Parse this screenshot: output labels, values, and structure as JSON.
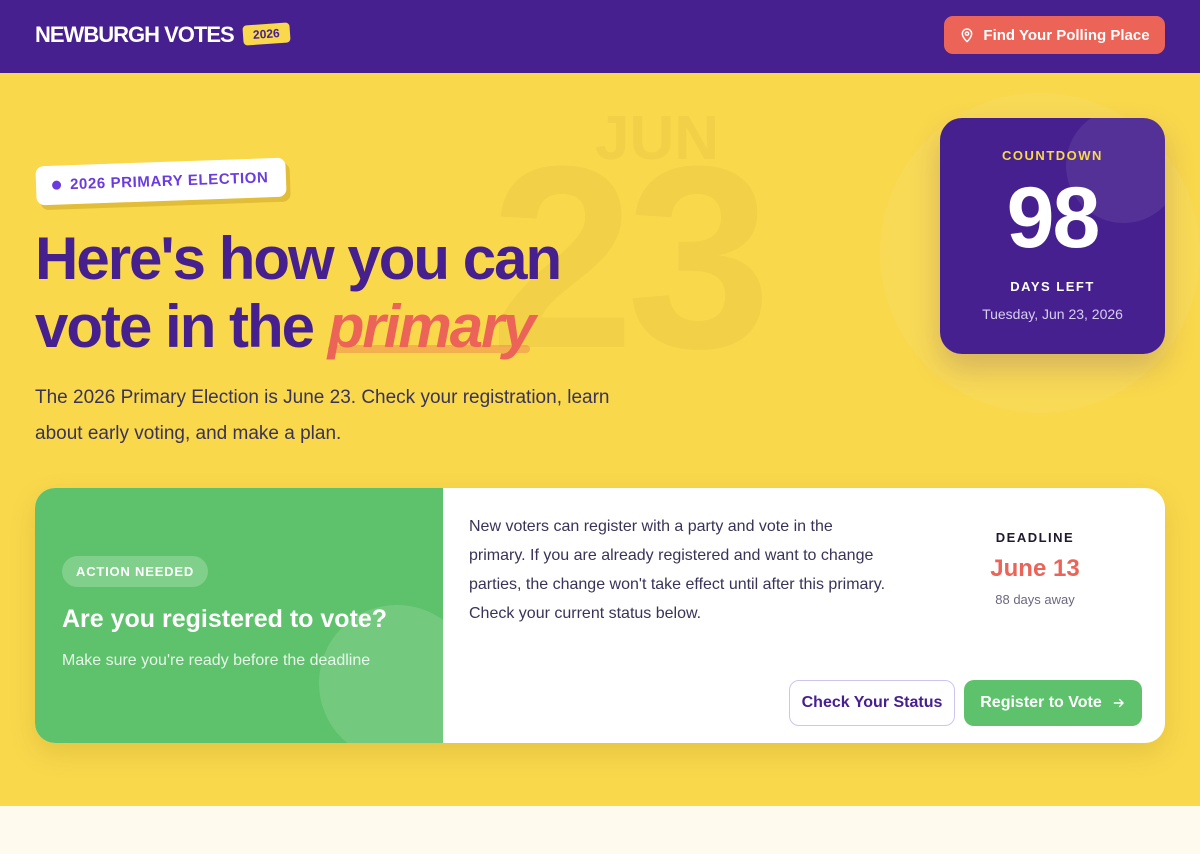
{
  "header": {
    "brand": "NEWBURGH VOTES",
    "year_badge": "2026",
    "polling_button": "Find Your Polling Place"
  },
  "hero": {
    "watermark_month": "JUN",
    "watermark_day": "23",
    "tag": "2026 PRIMARY ELECTION",
    "headline_line1": "Here's how you can",
    "headline_line2_prefix": "vote in the ",
    "headline_emphasis": "primary",
    "intro": "The 2026 Primary Election is June 23. Check your registration, learn about early voting, and make a plan."
  },
  "countdown": {
    "label": "COUNTDOWN",
    "value": "98",
    "sublabel": "DAYS LEFT",
    "date": "Tuesday, Jun 23, 2026"
  },
  "registration": {
    "pill": "ACTION NEEDED",
    "question": "Are you registered to vote?",
    "subtext": "Make sure you're ready before the deadline",
    "body": "New voters can register with a party and vote in the primary. If you are already registered and want to change parties, the change won't take effect until after this primary. Check your current status below.",
    "deadline_label": "DEADLINE",
    "deadline_date": "June 13",
    "deadline_away": "88 days away",
    "check_button": "Check Your Status",
    "register_button": "Register to Vote"
  },
  "colors": {
    "header_bg": "#46208F",
    "hero_bg": "#F9D84C",
    "accent_red": "#EC6457",
    "accent_green": "#5DC26B",
    "accent_purple": "#6A3CE0"
  },
  "icons": {
    "polling": "map-pin-icon",
    "register_arrow": "arrow-right-icon"
  }
}
